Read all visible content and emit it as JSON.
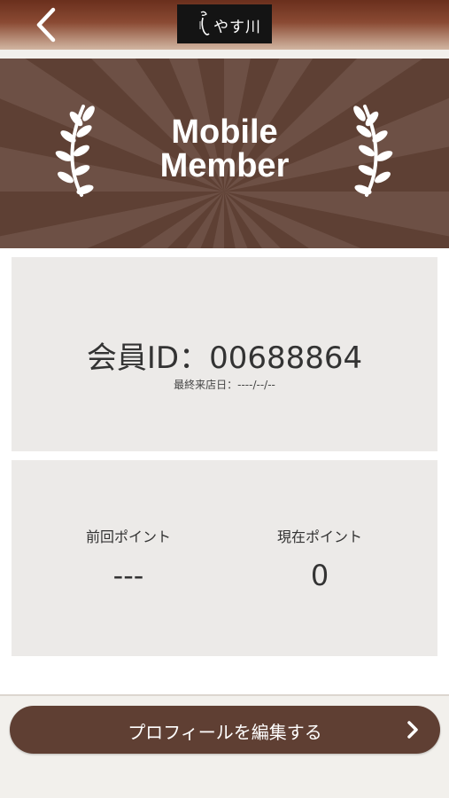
{
  "header": {
    "back_icon": "chevron-left-icon",
    "logo_text": "やす川",
    "logo_mark": "logo-mark-icon"
  },
  "banner": {
    "title_line1": "Mobile",
    "title_line2": "Member",
    "decoration": "laurel-icon"
  },
  "member": {
    "id_label": "会員ID：00688864",
    "last_visit": "最終来店日：----/--/--"
  },
  "points": {
    "previous_label": "前回ポイント",
    "previous_value": "---",
    "current_label": "現在ポイント",
    "current_value": "0"
  },
  "actions": {
    "edit_profile_label": "プロフィールを編集する",
    "edit_icon": "chevron-right-icon"
  },
  "colors": {
    "header_dark": "#6a2f1d",
    "banner_brown": "#5e4034",
    "button_brown": "#5f3f33",
    "card_gray": "#eceae8"
  }
}
